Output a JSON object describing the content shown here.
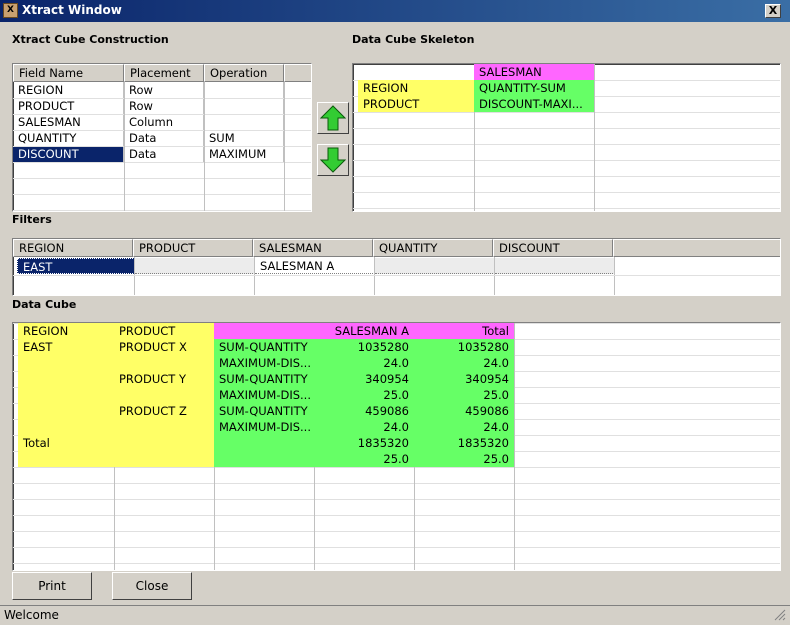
{
  "window": {
    "title": "Xtract Window",
    "close_glyph": "X"
  },
  "construction": {
    "label": "Xtract Cube Construction",
    "headers": [
      "Field Name",
      "Placement",
      "Operation"
    ],
    "rows": [
      {
        "field": "REGION",
        "placement": "Row",
        "operation": ""
      },
      {
        "field": "PRODUCT",
        "placement": "Row",
        "operation": ""
      },
      {
        "field": "SALESMAN",
        "placement": "Column",
        "operation": ""
      },
      {
        "field": "QUANTITY",
        "placement": "Data",
        "operation": "SUM"
      },
      {
        "field": "DISCOUNT",
        "placement": "Data",
        "operation": "MAXIMUM"
      }
    ],
    "selected_row": 4
  },
  "move_buttons": {
    "up_icon": "arrow-up-icon",
    "down_icon": "arrow-down-icon",
    "color": "#33cc33"
  },
  "skeleton": {
    "label": "Data Cube Skeleton",
    "salesman": "SALESMAN",
    "row1": [
      "REGION",
      "QUANTITY-SUM"
    ],
    "row2": [
      "PRODUCT",
      "DISCOUNT-MAXI..."
    ]
  },
  "filters": {
    "label": "Filters",
    "headers": [
      "REGION",
      "PRODUCT",
      "SALESMAN",
      "QUANTITY",
      "DISCOUNT"
    ],
    "row": [
      "EAST",
      "",
      "SALESMAN A",
      "",
      ""
    ]
  },
  "datacube": {
    "label": "Data Cube",
    "header": [
      "REGION",
      "PRODUCT",
      "",
      "SALESMAN A",
      "Total"
    ],
    "rows": [
      [
        "EAST",
        "PRODUCT X",
        "SUM-QUANTITY",
        "1035280",
        "1035280"
      ],
      [
        "",
        "",
        "MAXIMUM-DIS...",
        "24.0",
        "24.0"
      ],
      [
        "",
        "PRODUCT Y",
        "SUM-QUANTITY",
        "340954",
        "340954"
      ],
      [
        "",
        "",
        "MAXIMUM-DIS...",
        "25.0",
        "25.0"
      ],
      [
        "",
        "PRODUCT Z",
        "SUM-QUANTITY",
        "459086",
        "459086"
      ],
      [
        "",
        "",
        "MAXIMUM-DIS...",
        "24.0",
        "24.0"
      ],
      [
        "Total",
        "",
        "",
        "1835320",
        "1835320"
      ],
      [
        "",
        "",
        "",
        "25.0",
        "25.0"
      ]
    ]
  },
  "buttons": {
    "print": "Print",
    "close": "Close"
  },
  "status": {
    "text": "Welcome"
  },
  "colors": {
    "row_header": "#ffff66",
    "data": "#66ff66",
    "column_header": "#ff66ff",
    "selection": "#0a246a"
  }
}
